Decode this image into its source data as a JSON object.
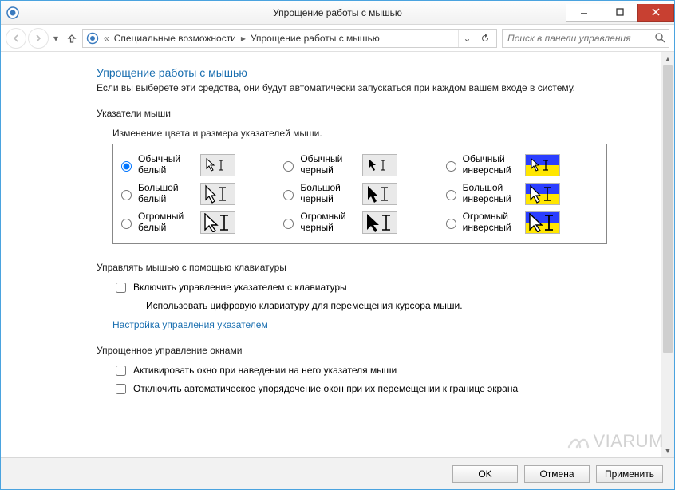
{
  "window": {
    "title": "Упрощение работы с мышью"
  },
  "nav": {
    "crumb1": "Специальные возможности",
    "crumb2": "Упрощение работы с мышью",
    "search_placeholder": "Поиск в панели управления"
  },
  "page": {
    "title": "Упрощение работы с мышью",
    "description": "Если вы выберете эти средства, они будут автоматически запускаться при каждом вашем входе в систему."
  },
  "pointers": {
    "group_label": "Указатели мыши",
    "change_label": "Изменение цвета и размера указателей мыши.",
    "opts": {
      "nw": "Обычный белый",
      "nb": "Обычный черный",
      "ni": "Обычный инверсный",
      "lw": "Большой белый",
      "lb": "Большой черный",
      "li": "Большой инверсный",
      "hw": "Огромный белый",
      "hb": "Огромный черный",
      "hi": "Огромный инверсный"
    }
  },
  "keyboard": {
    "group_label": "Управлять мышью с помощью клавиатуры",
    "enable_label": "Включить управление указателем с клавиатуры",
    "sub_desc": "Использовать цифровую клавиатуру для перемещения курсора мыши.",
    "link": "Настройка управления указателем"
  },
  "windows_mgmt": {
    "group_label": "Упрощенное управление окнами",
    "activate_label": "Активировать окно при наведении на него указателя мыши",
    "disable_snap_label": "Отключить автоматическое упорядочение окон при их перемещении к границе экрана"
  },
  "buttons": {
    "ok": "OK",
    "cancel": "Отмена",
    "apply": "Применить"
  },
  "watermark": "VIARUM"
}
